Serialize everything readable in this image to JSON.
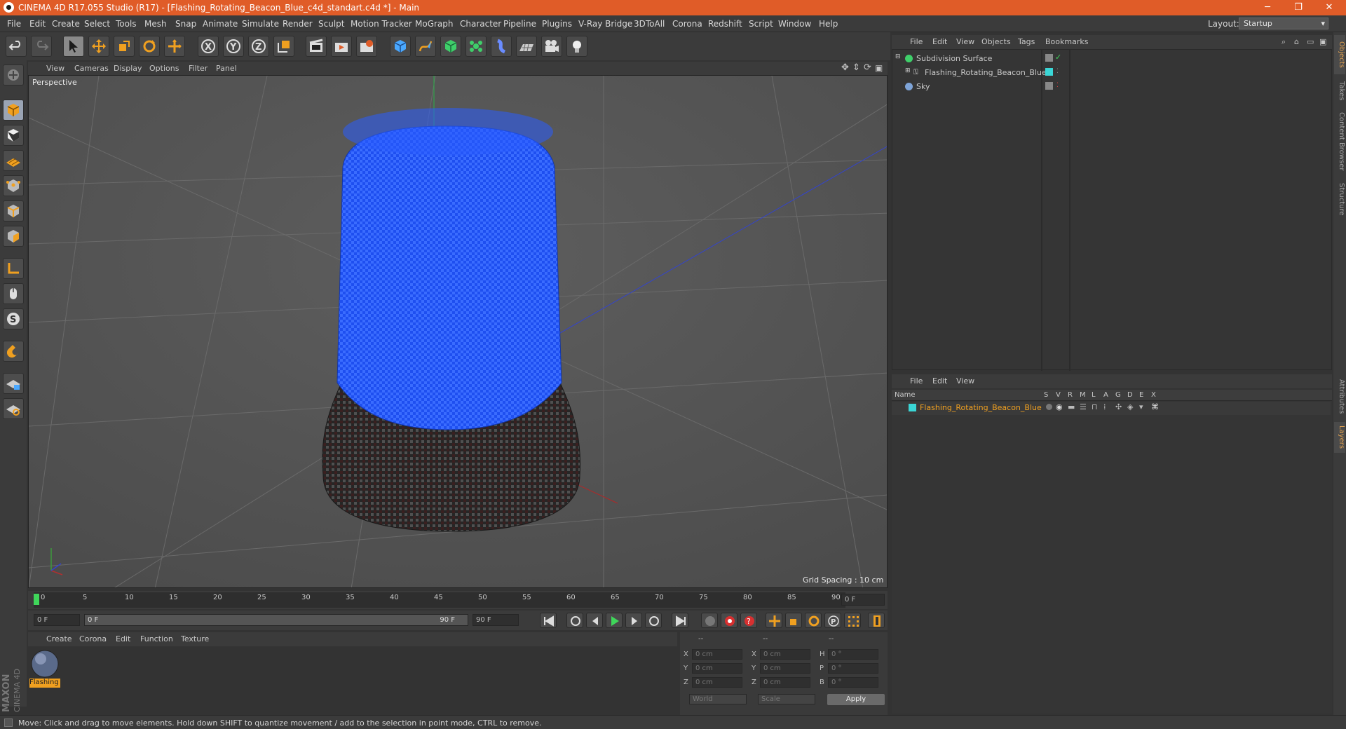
{
  "titlebar": {
    "title": "CINEMA 4D R17.055 Studio (R17) - [Flashing_Rotating_Beacon_Blue_c4d_standart.c4d *] - Main",
    "min": "─",
    "restore": "❐",
    "close": "✕"
  },
  "menubar": {
    "items": [
      "File",
      "Edit",
      "Create",
      "Select",
      "Tools",
      "Mesh",
      "Snap",
      "Animate",
      "Simulate",
      "Render",
      "Sculpt",
      "Motion Tracker",
      "MoGraph",
      "Character",
      "Pipeline",
      "Plugins",
      "V-Ray Bridge",
      "3DToAll",
      "Corona",
      "Redshift",
      "Script",
      "Window",
      "Help"
    ],
    "layout_label": "Layout:",
    "layout_value": "Startup"
  },
  "viewport": {
    "menu": [
      "View",
      "Cameras",
      "Display",
      "Options",
      "Filter",
      "Panel"
    ],
    "label": "Perspective",
    "grid_spacing": "Grid Spacing : 10 cm"
  },
  "timeline": {
    "ticks": [
      "0",
      "5",
      "10",
      "15",
      "20",
      "25",
      "30",
      "35",
      "40",
      "45",
      "50",
      "55",
      "60",
      "65",
      "70",
      "75",
      "80",
      "85",
      "90"
    ],
    "current_frame": "0 F"
  },
  "timectrl": {
    "start": "0 F",
    "range_start": "0 F",
    "range_end": "90 F",
    "end": "90 F"
  },
  "materials": {
    "menu": [
      "Create",
      "Corona",
      "Edit",
      "Function",
      "Texture"
    ],
    "material_name": "Flashing"
  },
  "coords": {
    "header": [
      "--",
      "--",
      "--"
    ],
    "rows": [
      {
        "a": "X",
        "av": "0 cm",
        "b": "X",
        "bv": "0 cm",
        "c": "H",
        "cv": "0 °"
      },
      {
        "a": "Y",
        "av": "0 cm",
        "b": "Y",
        "bv": "0 cm",
        "c": "P",
        "cv": "0 °"
      },
      {
        "a": "Z",
        "av": "0 cm",
        "b": "Z",
        "bv": "0 cm",
        "c": "B",
        "cv": "0 °"
      }
    ],
    "world": "World",
    "scale": "Scale",
    "apply": "Apply"
  },
  "objects": {
    "menu": [
      "File",
      "Edit",
      "View",
      "Objects",
      "Tags",
      "Bookmarks"
    ],
    "items": [
      "Subdivision Surface",
      "Flashing_Rotating_Beacon_Blue",
      "Sky"
    ]
  },
  "layers": {
    "menu": [
      "File",
      "Edit",
      "View"
    ],
    "name_col": "Name",
    "cols": [
      "S",
      "V",
      "R",
      "M",
      "L",
      "A",
      "G",
      "D",
      "E",
      "X"
    ],
    "item": "Flashing_Rotating_Beacon_Blue"
  },
  "right_tabs": [
    "Objects",
    "Takes",
    "Content Browser",
    "Structure",
    "Attributes",
    "Layers"
  ],
  "statusbar": {
    "text": "Move: Click and drag to move elements. Hold down SHIFT to quantize movement / add to the selection in point mode, CTRL to remove."
  },
  "maxon": {
    "line1": "MAXON",
    "line2": "CINEMA 4D"
  },
  "colors": {
    "accent": "#e05c28",
    "beacon_blue": "#1e50f0",
    "layer_cyan": "#3ad6d6",
    "active_orange": "#f0a020"
  }
}
